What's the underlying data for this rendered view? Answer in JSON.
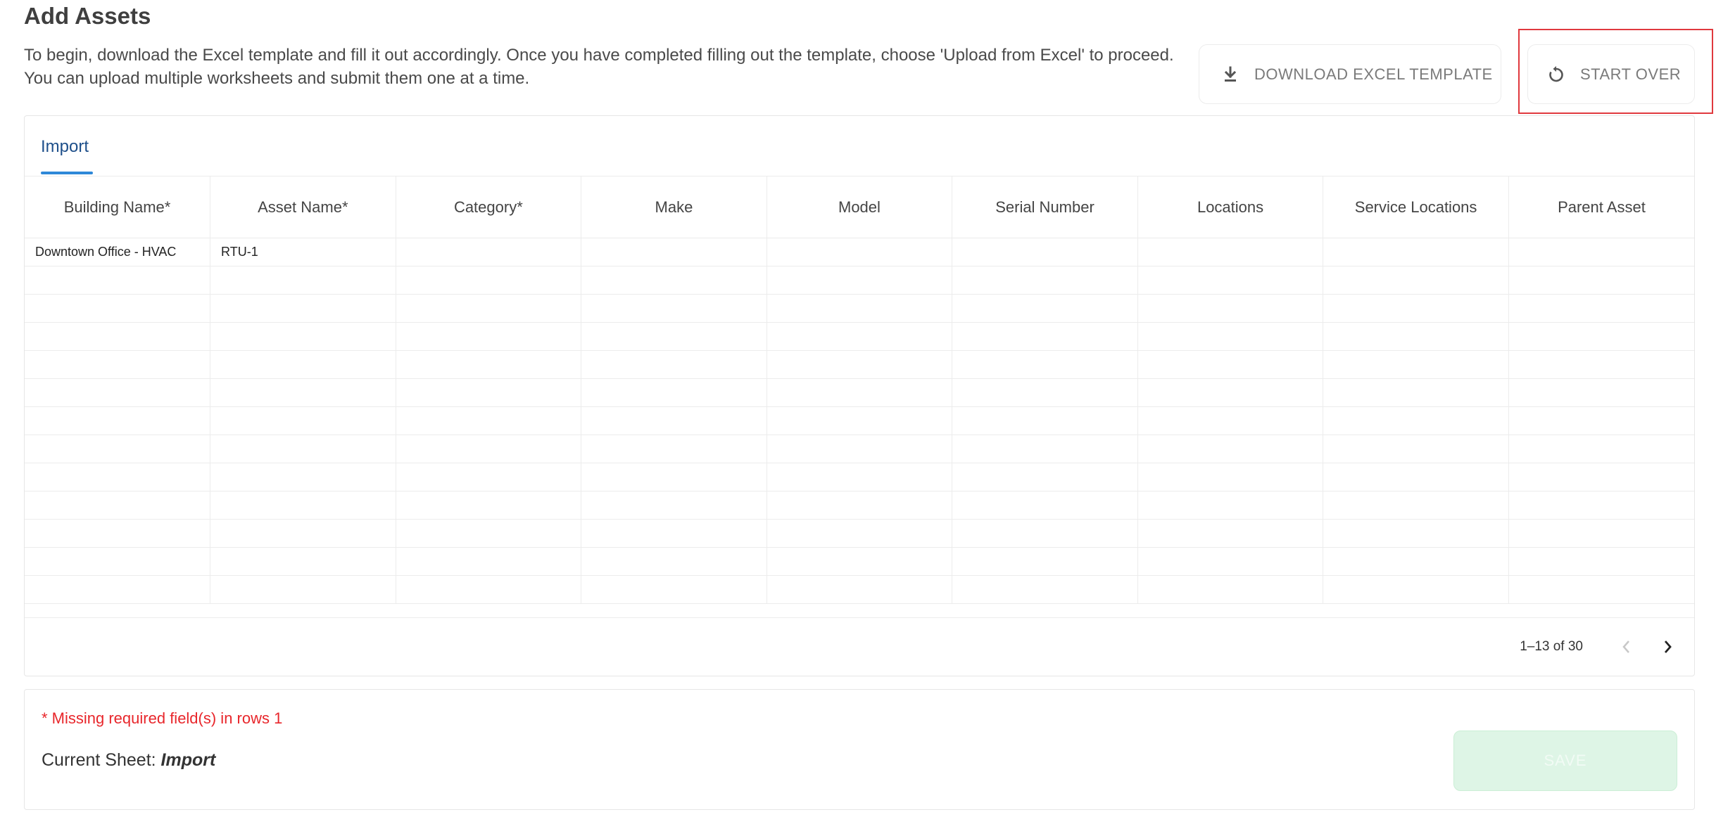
{
  "page": {
    "title": "Add Assets",
    "intro": "To begin, download the Excel template and fill it out accordingly. Once you have completed filling out the template, choose 'Upload from Excel' to proceed. You can upload multiple worksheets and submit them one at a time."
  },
  "toolbar": {
    "download_label": "DOWNLOAD EXCEL TEMPLATE",
    "download_icon": "download-icon",
    "start_over_label": "START OVER",
    "start_over_icon": "refresh-icon"
  },
  "tabs": [
    {
      "label": "Import",
      "active": true
    }
  ],
  "table": {
    "columns": [
      "Building Name*",
      "Asset Name*",
      "Category*",
      "Make",
      "Model",
      "Serial Number",
      "Locations",
      "Service Locations",
      "Parent Asset"
    ],
    "rows": [
      [
        "Downtown Office - HVAC",
        "RTU-1",
        "",
        "",
        "",
        "",
        "",
        "",
        ""
      ],
      [
        "",
        "",
        "",
        "",
        "",
        "",
        "",
        "",
        ""
      ],
      [
        "",
        "",
        "",
        "",
        "",
        "",
        "",
        "",
        ""
      ],
      [
        "",
        "",
        "",
        "",
        "",
        "",
        "",
        "",
        ""
      ],
      [
        "",
        "",
        "",
        "",
        "",
        "",
        "",
        "",
        ""
      ],
      [
        "",
        "",
        "",
        "",
        "",
        "",
        "",
        "",
        ""
      ],
      [
        "",
        "",
        "",
        "",
        "",
        "",
        "",
        "",
        ""
      ],
      [
        "",
        "",
        "",
        "",
        "",
        "",
        "",
        "",
        ""
      ],
      [
        "",
        "",
        "",
        "",
        "",
        "",
        "",
        "",
        ""
      ],
      [
        "",
        "",
        "",
        "",
        "",
        "",
        "",
        "",
        ""
      ],
      [
        "",
        "",
        "",
        "",
        "",
        "",
        "",
        "",
        ""
      ],
      [
        "",
        "",
        "",
        "",
        "",
        "",
        "",
        "",
        ""
      ],
      [
        "",
        "",
        "",
        "",
        "",
        "",
        "",
        "",
        ""
      ]
    ]
  },
  "pagination": {
    "range_text": "1–13 of 30",
    "prev_icon": "chevron-left-icon",
    "next_icon": "chevron-right-icon"
  },
  "footer": {
    "warning": "* Missing required field(s) in rows 1",
    "current_sheet_label": "Current Sheet:",
    "current_sheet_name": "Import",
    "save_label": "SAVE"
  },
  "colors": {
    "accent": "#2e88d8",
    "tab_text": "#1e4f8a",
    "error": "#e8262b",
    "save_disabled_bg": "#def5e6",
    "highlight": "#e0393e"
  }
}
